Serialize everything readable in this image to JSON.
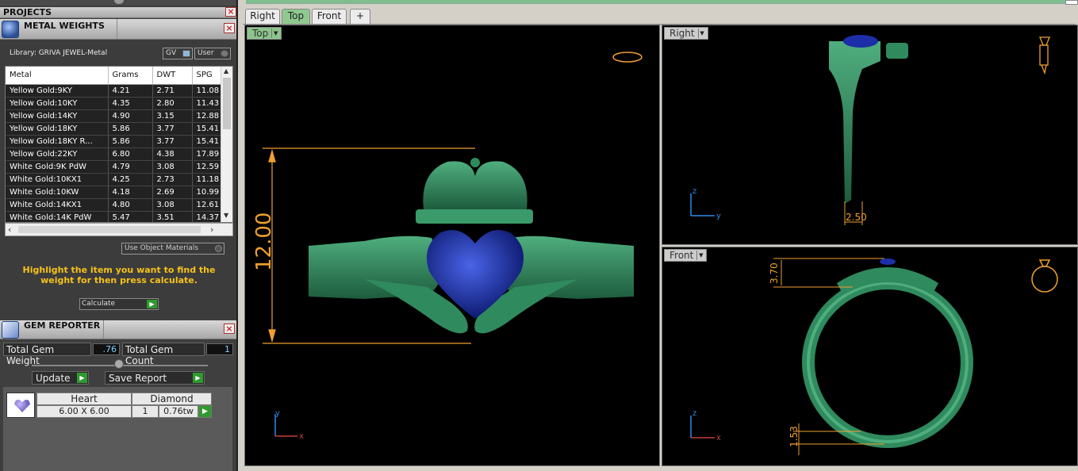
{
  "projects_panel": {
    "title": "PROJECTS",
    "close": "×"
  },
  "metal_weights": {
    "title": "METAL WEIGHTS",
    "close": "×",
    "library": "Library: GRIVA JEWEL-Metal",
    "toggle_gv": "GV",
    "toggle_user": "User",
    "columns": [
      "Metal",
      "Grams",
      "DWT",
      "SPG"
    ],
    "rows": [
      [
        "Yellow Gold:9KY",
        "4.21",
        "2.71",
        "11.08"
      ],
      [
        "Yellow Gold:10KY",
        "4.35",
        "2.80",
        "11.43"
      ],
      [
        "Yellow Gold:14KY",
        "4.90",
        "3.15",
        "12.88"
      ],
      [
        "Yellow Gold:18KY",
        "5.86",
        "3.77",
        "15.41"
      ],
      [
        "Yellow Gold:18KY R...",
        "5.86",
        "3.77",
        "15.41"
      ],
      [
        "Yellow Gold:22KY",
        "6.80",
        "4.38",
        "17.89"
      ],
      [
        "White Gold:9K PdW",
        "4.79",
        "3.08",
        "12.59"
      ],
      [
        "White Gold:10KX1",
        "4.25",
        "2.73",
        "11.18"
      ],
      [
        "White Gold:10KW",
        "4.18",
        "2.69",
        "10.99"
      ],
      [
        "White Gold:14KX1",
        "4.80",
        "3.08",
        "12.61"
      ],
      [
        "White Gold:14K PdW",
        "5.47",
        "3.51",
        "14.37"
      ]
    ],
    "use_object_materials": "Use Object Materials",
    "hint": "Highlight the item you want to find the weight for then press calculate.",
    "calculate": "Calculate"
  },
  "gem_reporter": {
    "title": "GEM REPORTER",
    "close": "×",
    "total_weight_label": "Total Gem Weight",
    "total_weight_value": ".76",
    "total_count_label": "Total Gem Count",
    "total_count_value": "1",
    "update": "Update",
    "save_report": "Save Report",
    "headers": [
      "Heart",
      "Diamond"
    ],
    "row": {
      "size": "6.00 X 6.00",
      "count": "1",
      "weight": "0.76tw"
    }
  },
  "tabs": [
    "Right",
    "Top",
    "Front",
    "+"
  ],
  "active_tab": "Top",
  "viewports": {
    "top": {
      "label": "Top",
      "dimension": "12.00",
      "axis_x": "x",
      "axis_y": "y"
    },
    "right": {
      "label": "Right",
      "dimension": "2.50",
      "axis_h": "y",
      "axis_v": "z"
    },
    "front": {
      "label": "Front",
      "dimension_top": "3.70",
      "dimension_bottom": "1.53",
      "axis_h": "x",
      "axis_v": "z"
    }
  },
  "colors": {
    "ring": "#2f8a5e",
    "gem": "#1c2fa8",
    "dimension": "#f0a030",
    "accent_tab": "#8fc98f"
  }
}
